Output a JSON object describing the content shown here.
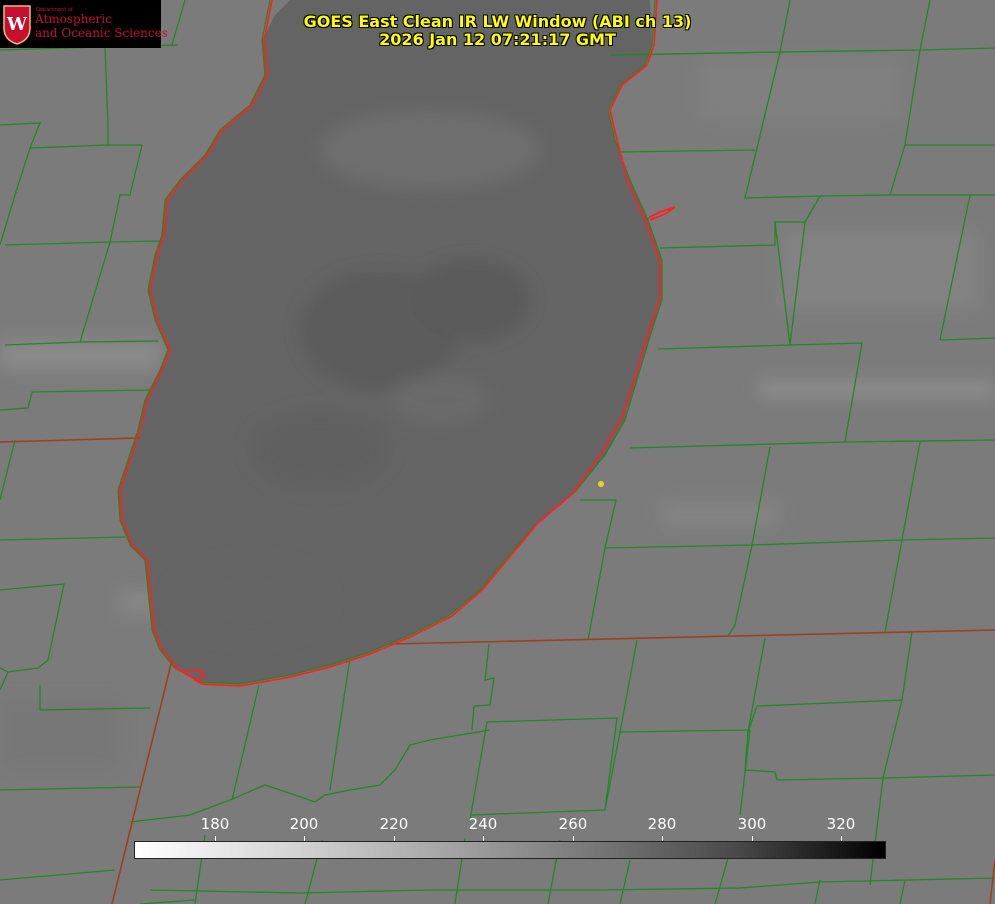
{
  "header": {
    "title_line1": "GOES East Clean IR LW Window (ABI ch 13)",
    "title_line2": "2026 Jan 12 07:21:17 GMT"
  },
  "logo": {
    "small_text": "Department of",
    "line1": "Atmospheric",
    "line2": "and Oceanic Sciences",
    "brand_color": "#c8102e"
  },
  "colorbar": {
    "ticks": [
      "180",
      "200",
      "220",
      "240",
      "260",
      "280",
      "300",
      "320"
    ]
  },
  "colors": {
    "county_lines": "#1f8a1f",
    "coastline": "#ff2222",
    "state_lines": "#a0401a",
    "title": "#ffff00",
    "city_marker": "#e5d81a"
  }
}
